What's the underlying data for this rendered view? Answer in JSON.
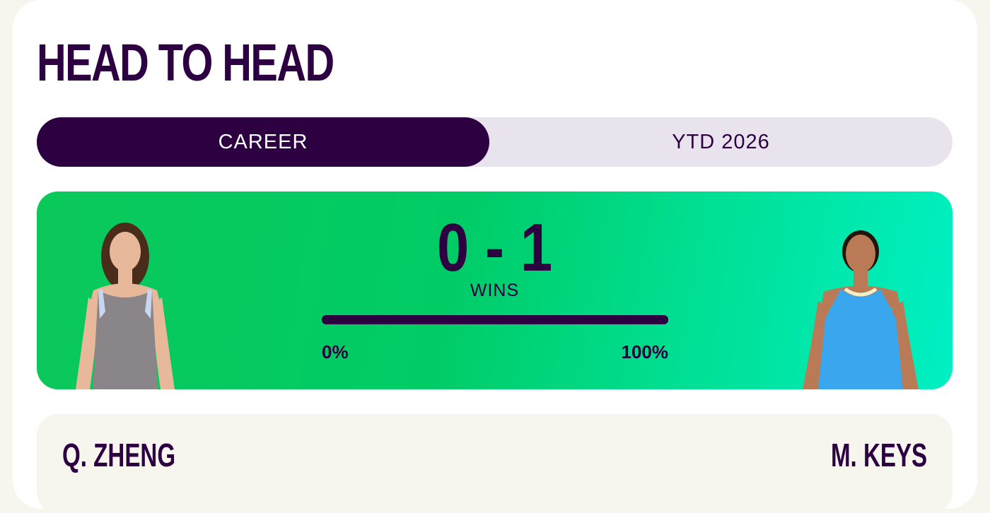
{
  "header": {
    "title": "HEAD TO HEAD"
  },
  "tabs": [
    {
      "label": "CAREER",
      "active": true
    },
    {
      "label": "YTD 2026",
      "active": false
    }
  ],
  "scoreboard": {
    "score": "0 - 1",
    "score_label": "WINS",
    "win_share_left": 0,
    "bar_min_label": "0%",
    "bar_max_label": "100%"
  },
  "players": {
    "left": {
      "name": "Q. ZHENG",
      "outfit_color": "#8a8589",
      "skin_color": "#e7b99a",
      "hair_color": "#4a2c1a"
    },
    "right": {
      "name": "M. KEYS",
      "outfit_color": "#3aa6ee",
      "skin_color": "#b97a55",
      "hair_color": "#1f140e"
    }
  },
  "colors": {
    "brand": "#2d0042",
    "tab_inactive_bg": "#e9e3ee",
    "scoreboard_gradient_start": "#0bc85a",
    "scoreboard_gradient_end": "#00f0c4"
  }
}
